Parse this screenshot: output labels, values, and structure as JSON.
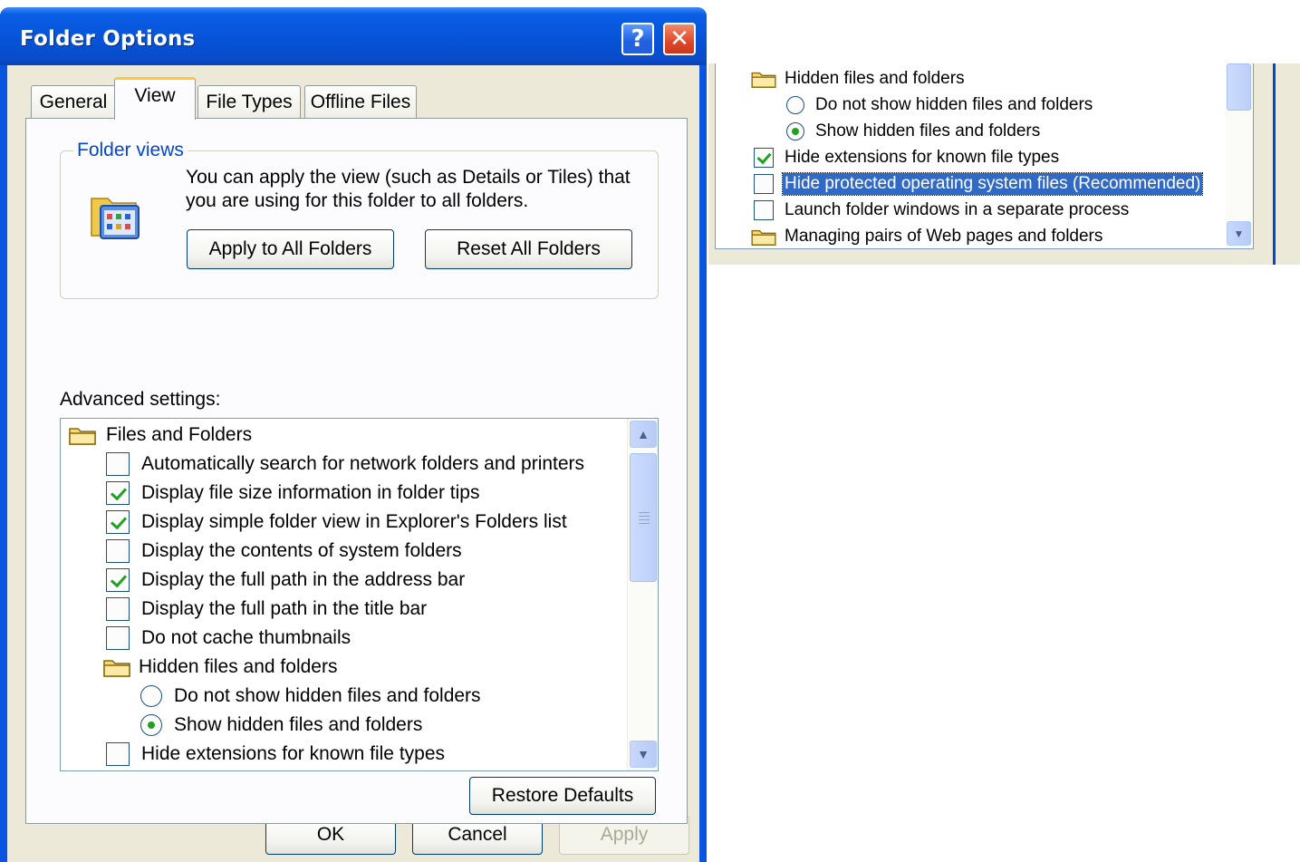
{
  "dialog": {
    "title": "Folder Options",
    "help_glyph": "?",
    "close_glyph": "✕"
  },
  "tabs": [
    {
      "label": "General",
      "active": false
    },
    {
      "label": "View",
      "active": true
    },
    {
      "label": "File Types",
      "active": false
    },
    {
      "label": "Offline Files",
      "active": false
    }
  ],
  "folder_views": {
    "legend": "Folder views",
    "description": "You can apply the view (such as Details or Tiles) that you are using for this folder to all folders.",
    "apply_button": "Apply to All Folders",
    "reset_button": "Reset All Folders"
  },
  "advanced": {
    "label": "Advanced settings:",
    "items": [
      {
        "type": "folder",
        "label": "Files and Folders"
      },
      {
        "type": "checkbox",
        "checked": false,
        "label": "Automatically search for network folders and printers"
      },
      {
        "type": "checkbox",
        "checked": true,
        "label": "Display file size information in folder tips"
      },
      {
        "type": "checkbox",
        "checked": true,
        "label": "Display simple folder view in Explorer's Folders list"
      },
      {
        "type": "checkbox",
        "checked": false,
        "label": "Display the contents of system folders"
      },
      {
        "type": "checkbox",
        "checked": true,
        "label": "Display the full path in the address bar"
      },
      {
        "type": "checkbox",
        "checked": false,
        "label": "Display the full path in the title bar"
      },
      {
        "type": "checkbox",
        "checked": false,
        "label": "Do not cache thumbnails"
      },
      {
        "type": "folder",
        "label": "Hidden files and folders"
      },
      {
        "type": "radio",
        "checked": false,
        "label": "Do not show hidden files and folders"
      },
      {
        "type": "radio",
        "checked": true,
        "label": "Show hidden files and folders"
      },
      {
        "type": "checkbox",
        "checked": false,
        "label": "Hide extensions for known file types"
      }
    ],
    "scroll_up_glyph": "▲",
    "scroll_down_glyph": "▼"
  },
  "buttons": {
    "restore_defaults": "Restore Defaults",
    "ok": "OK",
    "cancel": "Cancel",
    "apply": "Apply"
  },
  "zoom_snippet": {
    "items": [
      {
        "type": "folder",
        "label": "Hidden files and folders"
      },
      {
        "type": "radio",
        "checked": false,
        "label": "Do not show hidden files and folders"
      },
      {
        "type": "radio",
        "checked": true,
        "label": "Show hidden files and folders"
      },
      {
        "type": "checkbox",
        "checked": true,
        "label": "Hide extensions for known file types"
      },
      {
        "type": "checkbox",
        "checked": false,
        "selected": true,
        "label": "Hide protected operating system files (Recommended)"
      },
      {
        "type": "checkbox",
        "checked": false,
        "label": "Launch folder windows in a separate process"
      },
      {
        "type": "folder",
        "label": "Managing pairs of Web pages and folders"
      }
    ],
    "scroll_down_glyph": "▼"
  },
  "colors": {
    "title_bar": "#0653d8",
    "dialog_face": "#ece9d8",
    "legend_text": "#0046d5",
    "check_mark": "#21a121",
    "selection": "#316ac5",
    "annotation": "#e00000"
  }
}
